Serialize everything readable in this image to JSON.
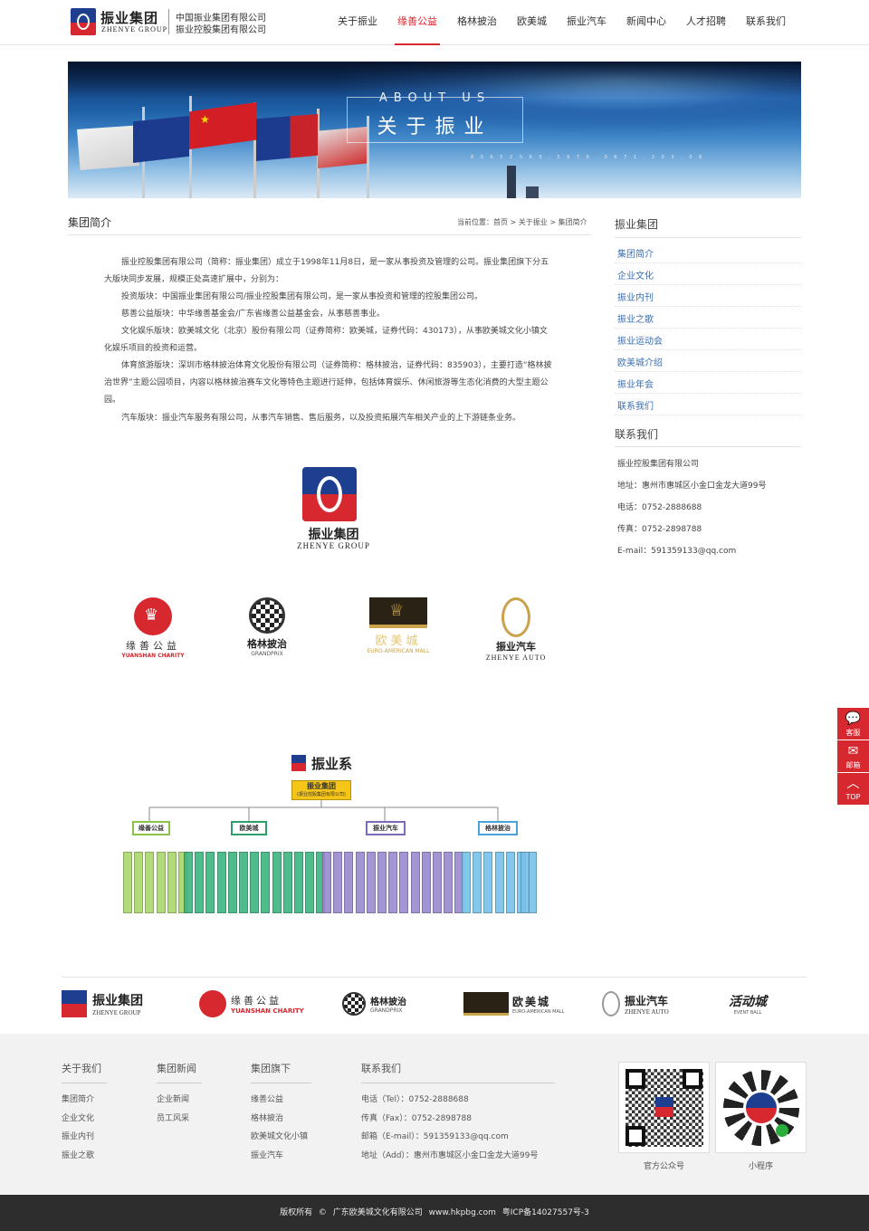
{
  "header": {
    "logo_cn": "振业集团",
    "logo_en": "ZHENYE GROUP",
    "company_line1": "中国振业集团有限公司",
    "company_line2": "振业控股集团有限公司",
    "nav": [
      "关于振业",
      "缘善公益",
      "格林披治",
      "欧美城",
      "振业汽车",
      "新闻中心",
      "人才招聘",
      "联系我们"
    ],
    "nav_active": "缘善公益"
  },
  "banner": {
    "en": "ABOUT US",
    "cn": "关于振业",
    "numbers": "8 0 6 5 2 5 6 5 . 5 9 7 6 . 0 6 7 1 . 2 0 3 . 0 6"
  },
  "main": {
    "title": "集团简介",
    "breadcrumb": "当前位置：首页 > 关于振业 > 集团简介",
    "paragraphs": [
      "振业控股集团有限公司（简称：振业集团）成立于1998年11月8日，是一家从事投资及管理的公司。振业集团旗下分五大版块同步发展，规模正处高速扩展中，分别为：",
      "投资版块：中国振业集团有限公司/振业控股集团有限公司，是一家从事投资和管理的控股集团公司。",
      "慈善公益版块：中华缘善基金会/广东省缘善公益基金会，从事慈善事业。",
      "文化娱乐版块：欧美城文化（北京）股份有限公司（证券简称：欧美城，证券代码：430173），从事欧美城文化小镇文化娱乐项目的投资和运营。",
      "体育旅游版块：深圳市格林披治体育文化股份有限公司（证券简称：格林披治，证券代码：835903），主要打造“格林披治世界”主题公园项目，内容以格林披治赛车文化等特色主题进行延伸，包括体育娱乐、休闲旅游等生态化消费的大型主题公园。",
      "汽车版块：振业汽车服务有限公司，从事汽车销售、售后服务，以及投资拓展汽车相关产业的上下游链条业务。"
    ],
    "big_logo_cn": "振业集团",
    "big_logo_en": "ZHENYE GROUP",
    "brands": [
      {
        "name": "缘善公益",
        "sub": "YUANSHAN CHARITY"
      },
      {
        "name": "格林披治",
        "sub": "GRANDPRIX"
      },
      {
        "name": "欧美城",
        "sub": "EURO-AMERICAN MALL"
      },
      {
        "name": "振业汽车",
        "sub": "ZHENYE AUTO"
      }
    ],
    "org": {
      "title": "振业系",
      "root": "振业集团",
      "root_sub": "(振业控股集团有限公司)",
      "branches": [
        {
          "name": "缘善公益",
          "color": "#8bc34a"
        },
        {
          "name": "欧美城",
          "color": "#2e9e6b"
        },
        {
          "name": "振业汽车",
          "color": "#7e6bb8"
        },
        {
          "name": "格林披治",
          "color": "#4aa3d8"
        }
      ]
    }
  },
  "sidebar": {
    "title": "振业集团",
    "links": [
      "集团简介",
      "企业文化",
      "振业内刊",
      "振业之歌",
      "振业运动会",
      "欧美城介绍",
      "振业年会",
      "联系我们"
    ],
    "contact_title": "联系我们",
    "contact": [
      "振业控股集团有限公司",
      "地址：惠州市惠城区小金口金龙大道99号",
      "电话：0752-2888688",
      "传真：0752-2898788",
      "E-mail：591359133@qq.com"
    ]
  },
  "float": {
    "service": "客服",
    "mail": "邮箱",
    "top": "TOP"
  },
  "partners": [
    {
      "name": "振业集团",
      "sub": "ZHENYE GROUP"
    },
    {
      "name": "缘善公益",
      "sub": "YUANSHAN CHARITY"
    },
    {
      "name": "格林披治",
      "sub": "GRANDPRIX"
    },
    {
      "name": "欧美城",
      "sub": "EURO-AMERICAN MALL"
    },
    {
      "name": "振业汽车",
      "sub": "ZHENYE AUTO"
    },
    {
      "name": "活动城",
      "sub": "EVENT BALL"
    }
  ],
  "footer": {
    "cols": [
      {
        "title": "关于我们",
        "links": [
          "集团简介",
          "企业文化",
          "振业内刊",
          "振业之歌"
        ]
      },
      {
        "title": "集团新闻",
        "links": [
          "企业新闻",
          "员工风采"
        ]
      },
      {
        "title": "集团旗下",
        "links": [
          "缘善公益",
          "格林披治",
          "欧美城文化小镇",
          "振业汽车"
        ]
      },
      {
        "title": "联系我们",
        "links": [
          "电话（Tel）：0752-2888688",
          "传真（Fax）：0752-2898788",
          "邮箱（E-mail）：591359133@qq.com",
          "地址（Add）：惠州市惠城区小金口金龙大道99号"
        ]
      }
    ],
    "qr1": "官方公众号",
    "qr2": "小程序",
    "copyright": "版权所有 © 广东欧美城文化有限公司  www.hkpbg.com  粤ICP备14027557号-3"
  },
  "colors": {
    "accent": "#d7282f",
    "brand_blue": "#1e3f8f",
    "link": "#3a6fb0"
  }
}
